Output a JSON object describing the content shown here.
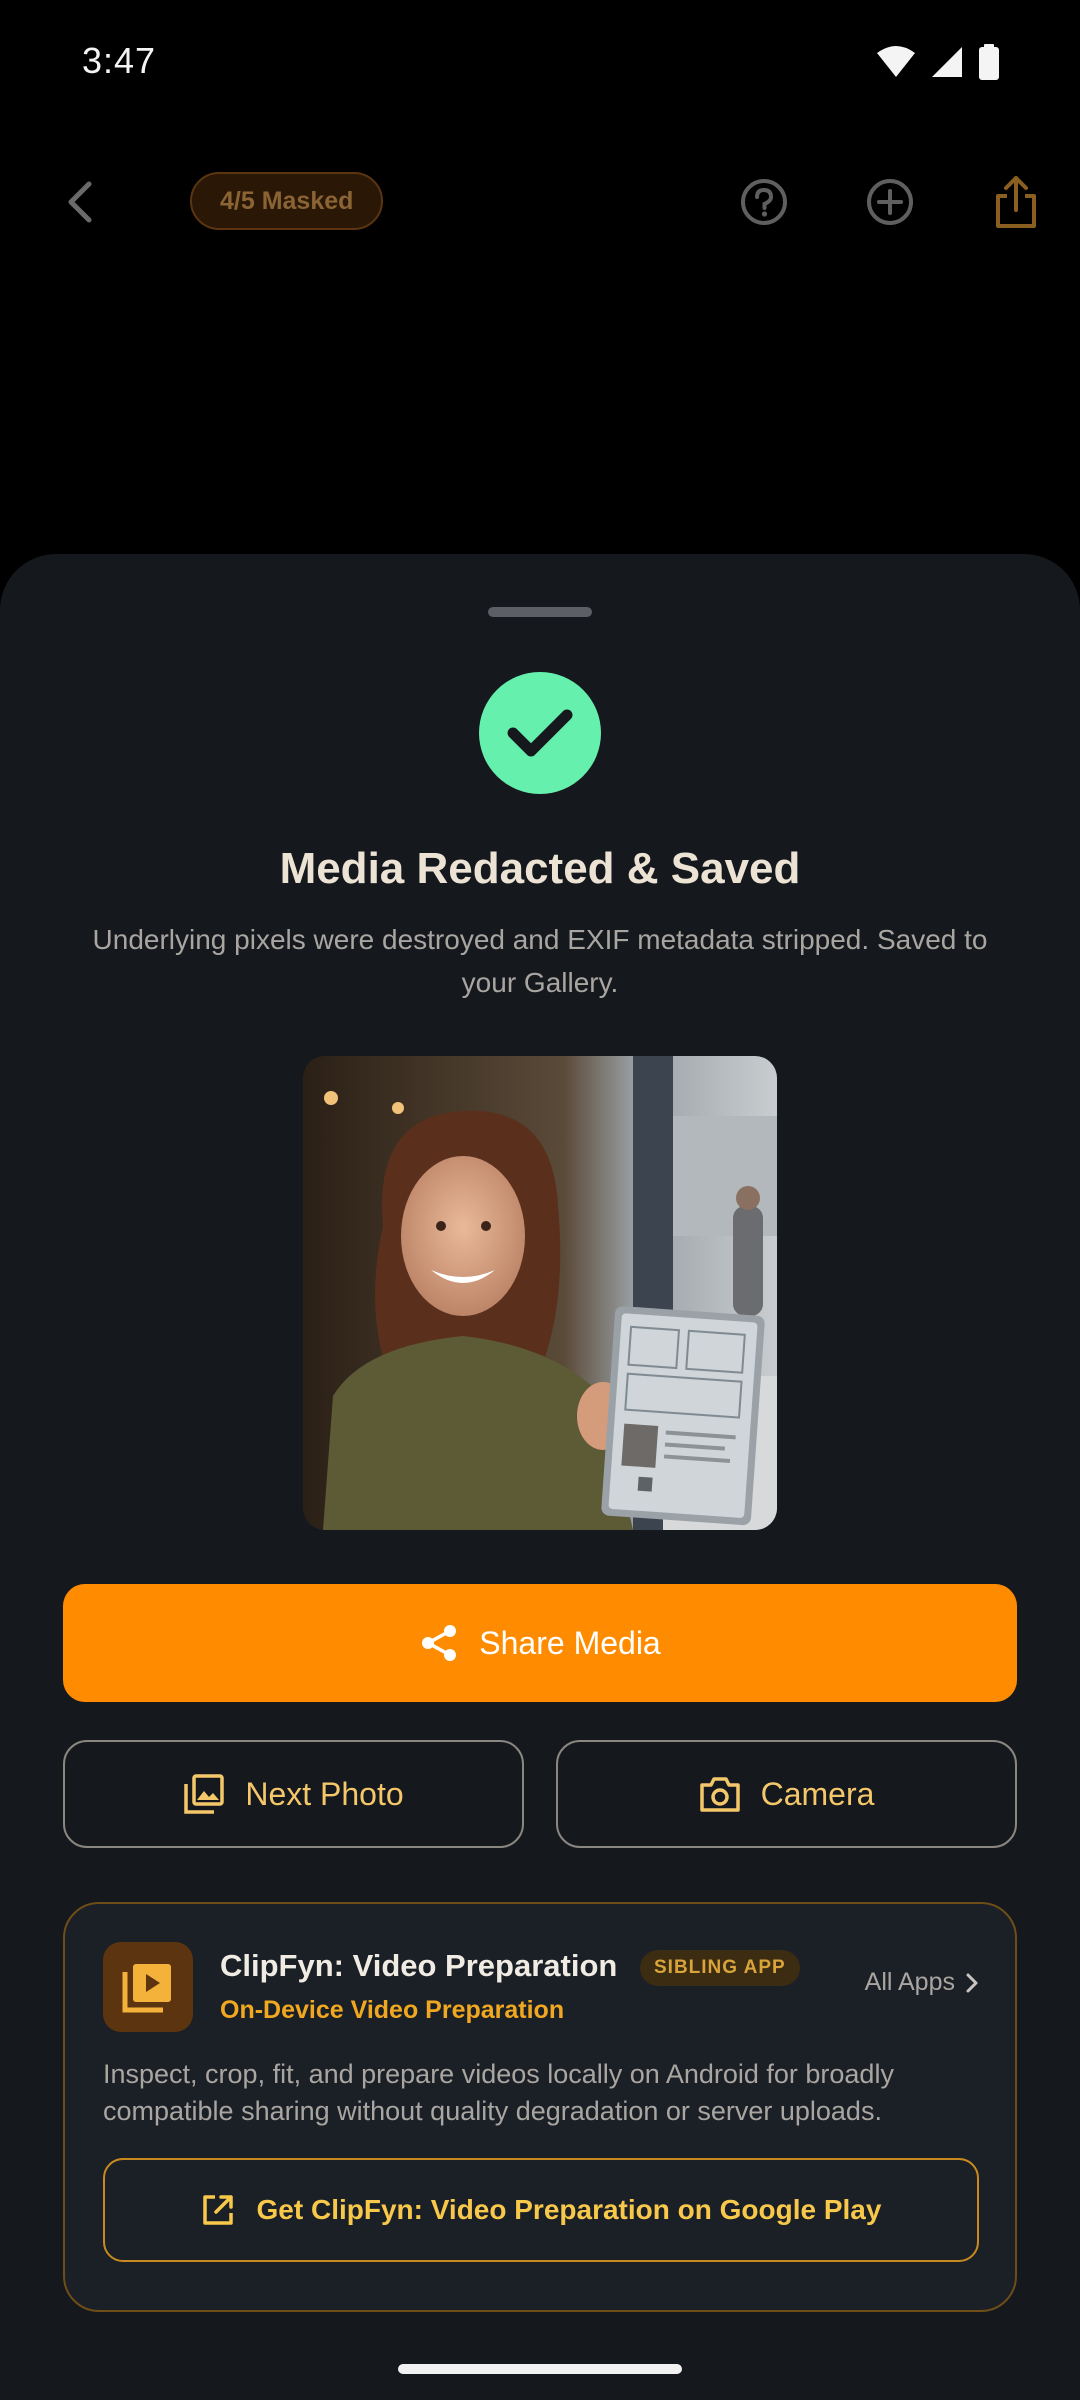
{
  "status_bar": {
    "time": "3:47",
    "icons": [
      "wifi-icon",
      "signal-icon",
      "battery-icon"
    ]
  },
  "app_bar": {
    "back_icon": "chevron-left-icon",
    "masked_chip": "4/5 Masked",
    "actions": [
      "help-circle-icon",
      "add-circle-icon",
      "share-upload-icon"
    ]
  },
  "sheet": {
    "status_icon": "check-icon",
    "title": "Media Redacted & Saved",
    "description": "Underlying pixels were destroyed and EXIF metadata stripped. Saved to your Gallery.",
    "photo_alt": "redacted-photo",
    "share_button": "Share Media",
    "next_photo_button": "Next Photo",
    "camera_button": "Camera"
  },
  "promo": {
    "app_name": "ClipFyn: Video Preparation",
    "badge": "SIBLING APP",
    "subtitle": "On-Device Video Preparation",
    "all_apps": "All Apps",
    "description": "Inspect, crop, fit, and prepare videos locally on Android for broadly compatible sharing without quality degradation or server uploads.",
    "play_button": "Get ClipFyn: Video Preparation on Google Play"
  },
  "colors": {
    "accent": "#ff8c00",
    "success": "#66f0ae",
    "sheet_bg": "#15181d",
    "gold_text": "#f4c76a"
  }
}
